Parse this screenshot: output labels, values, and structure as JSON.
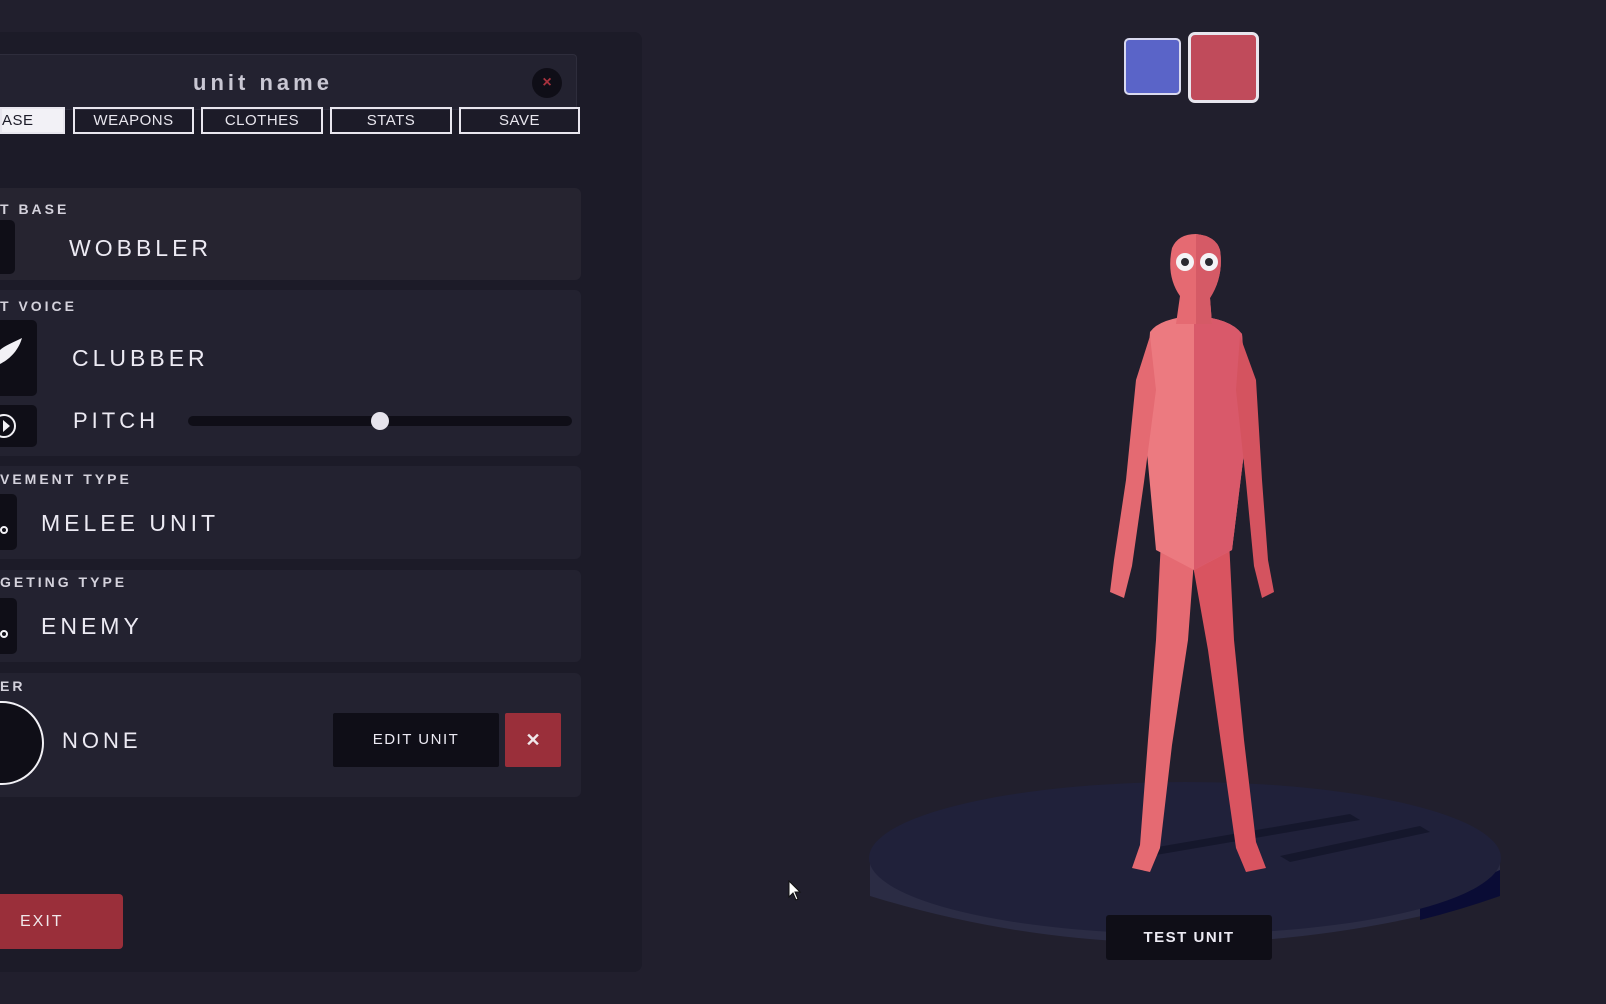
{
  "header": {
    "unit_name": "unit name",
    "close_label": "×"
  },
  "tabs": [
    {
      "label": "ASE",
      "active": true
    },
    {
      "label": "WEAPONS"
    },
    {
      "label": "CLOTHES"
    },
    {
      "label": "STATS"
    },
    {
      "label": "SAVE"
    }
  ],
  "base": {
    "label": "T BASE",
    "value": "WOBBLER"
  },
  "voice": {
    "label": "T VOICE",
    "value": "CLUBBER",
    "pitch_label": "PITCH",
    "pitch_level": 0.5
  },
  "movement": {
    "label": "VEMENT TYPE",
    "value": "MELEE UNIT"
  },
  "targeting": {
    "label": "GETING TYPE",
    "value": "ENEMY"
  },
  "rider": {
    "label": "ER",
    "value": "NONE",
    "edit_label": "EDIT UNIT",
    "remove_label": "✕"
  },
  "exit_label": "EXIT",
  "test_label": "TEST UNIT",
  "team_colors": {
    "blue": "#5a64c8",
    "red": "#c04b5b"
  },
  "colors": {
    "accent_red": "#9a2f3a",
    "unit_body": "#e56a72",
    "background": "#211f2d"
  }
}
